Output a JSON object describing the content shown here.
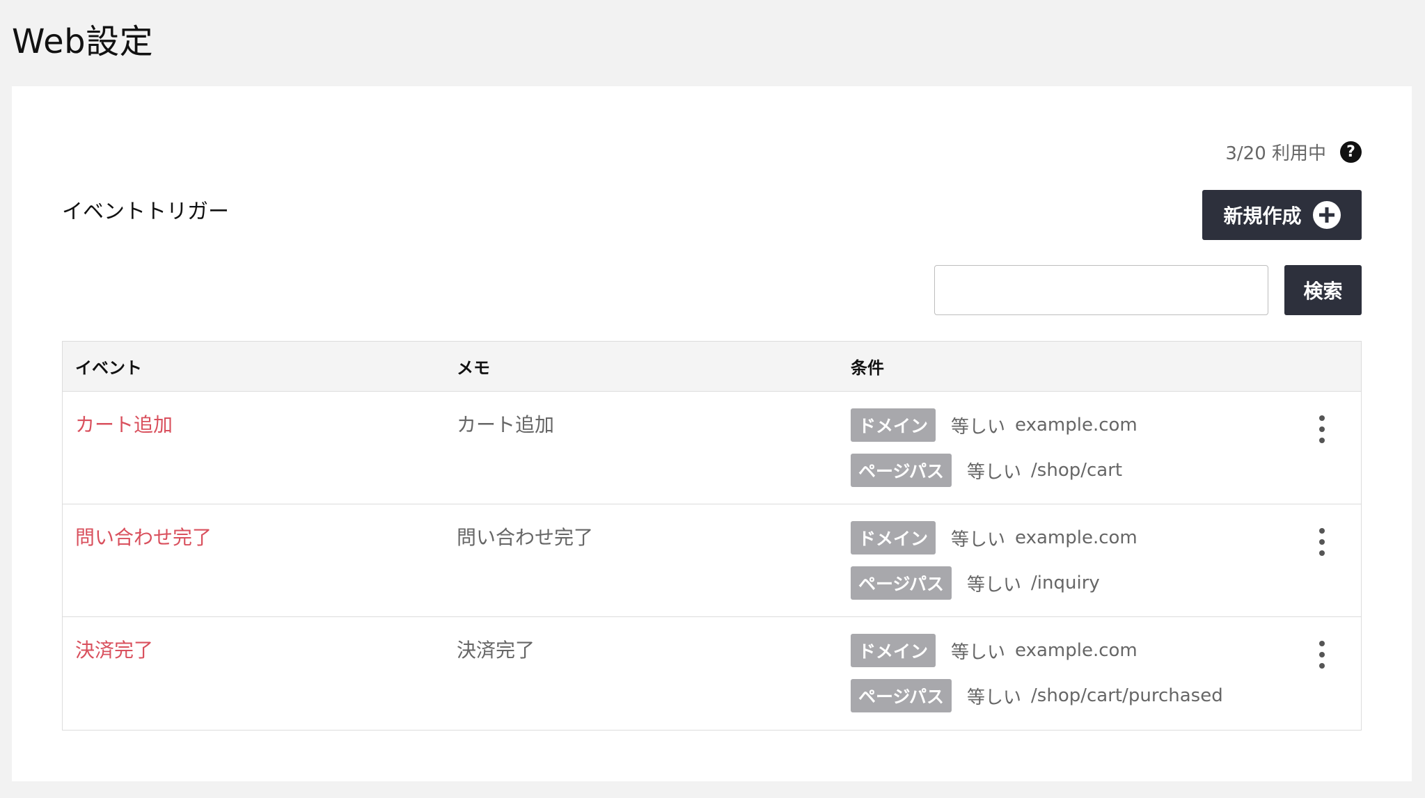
{
  "page": {
    "title": "Web設定"
  },
  "usage": {
    "text": "3/20 利用中",
    "help_symbol": "?"
  },
  "section": {
    "title": "イベントトリガー"
  },
  "actions": {
    "new_label": "新規作成",
    "search_label": "検索",
    "search_value": "",
    "search_placeholder": ""
  },
  "table": {
    "headers": {
      "event": "イベント",
      "memo": "メモ",
      "conditions": "条件"
    },
    "rows": [
      {
        "event": "カート追加",
        "memo": "カート追加",
        "conditions": [
          {
            "tag": "ドメイン",
            "op": "等しい",
            "value": "example.com"
          },
          {
            "tag": "ページパス",
            "op": "等しい",
            "value": "/shop/cart"
          }
        ]
      },
      {
        "event": "問い合わせ完了",
        "memo": "問い合わせ完了",
        "conditions": [
          {
            "tag": "ドメイン",
            "op": "等しい",
            "value": "example.com"
          },
          {
            "tag": "ページパス",
            "op": "等しい",
            "value": "/inquiry"
          }
        ]
      },
      {
        "event": "決済完了",
        "memo": "決済完了",
        "conditions": [
          {
            "tag": "ドメイン",
            "op": "等しい",
            "value": "example.com"
          },
          {
            "tag": "ページパス",
            "op": "等しい",
            "value": "/shop/cart/purchased"
          }
        ]
      }
    ]
  },
  "colors": {
    "accent_link": "#d9505d",
    "dark_button": "#2d303c",
    "tag_bg": "#a8a8ac"
  }
}
